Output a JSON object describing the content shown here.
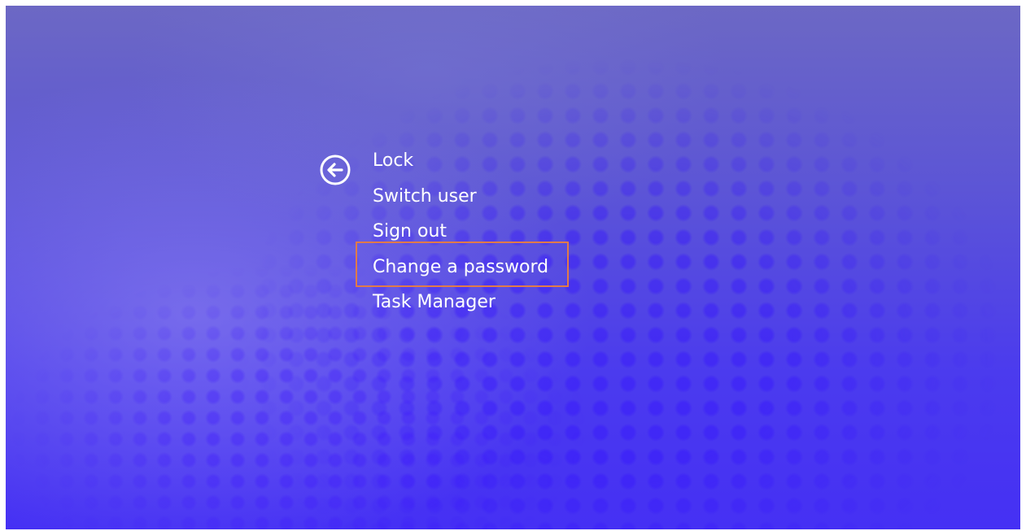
{
  "menu": {
    "items": [
      {
        "label": "Lock"
      },
      {
        "label": "Switch user"
      },
      {
        "label": "Sign out"
      },
      {
        "label": "Change a password"
      },
      {
        "label": "Task Manager"
      }
    ],
    "highlighted_item": "Change a password"
  },
  "icons": {
    "back": "back-arrow-circle-icon"
  },
  "colors": {
    "background_top": "#6c68c4",
    "background_bottom": "#4530f4",
    "text": "#ffffff",
    "highlight_border": "#e07a4a"
  }
}
